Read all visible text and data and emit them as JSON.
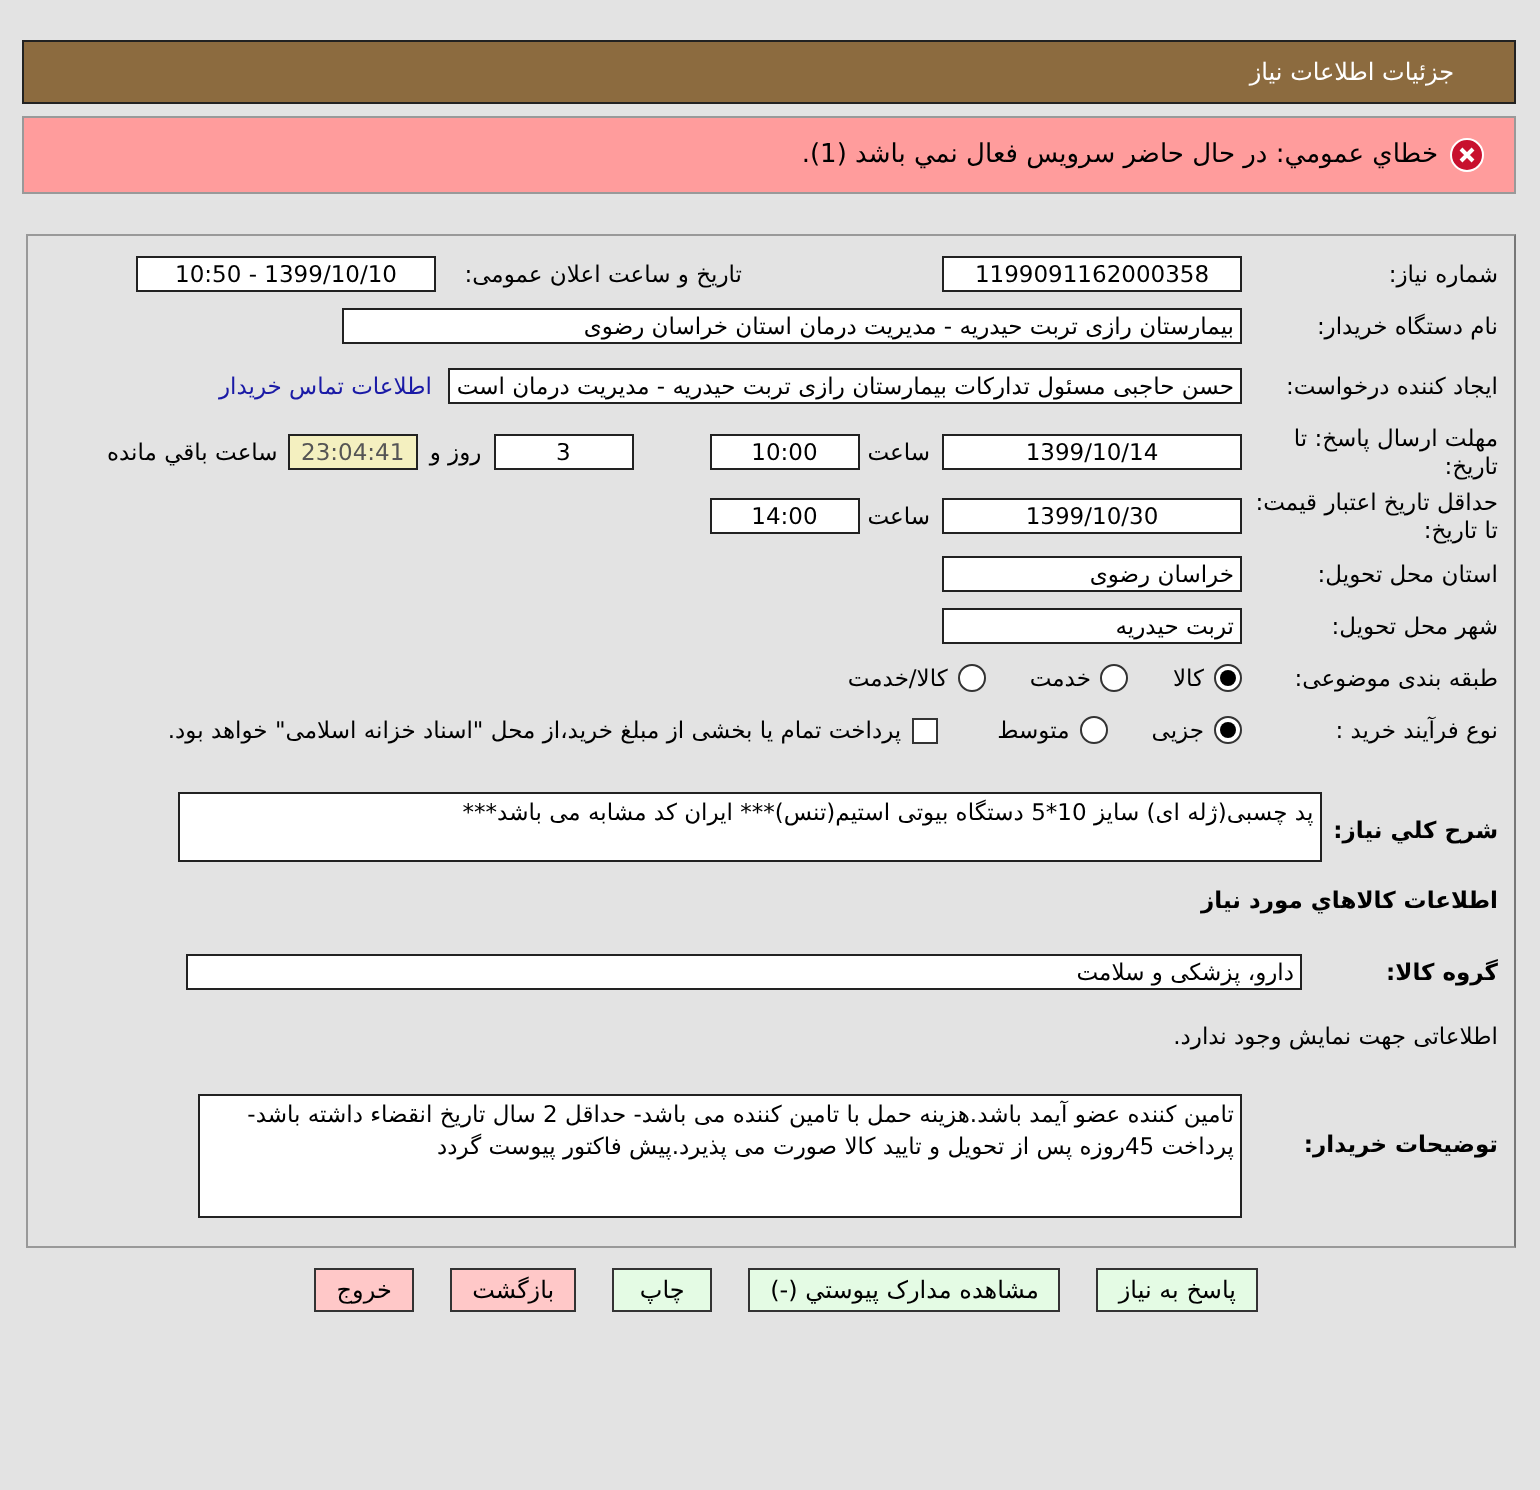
{
  "header": {
    "title": "جزئیات اطلاعات نیاز"
  },
  "error": {
    "message": "خطاي عمومي: در حال حاضر سرويس فعال نمي باشد (1)."
  },
  "need_number": {
    "label": "شماره نیاز:",
    "value": "1199091162000358"
  },
  "announce": {
    "label": "تاریخ و ساعت اعلان عمومی:",
    "value": "1399/10/10 - 10:50"
  },
  "buyer_org": {
    "label": "نام دستگاه خریدار:",
    "value": "بیمارستان رازی تربت حیدریه - مدیریت درمان استان خراسان رضوی"
  },
  "requester": {
    "label": "ایجاد کننده درخواست:",
    "value": "حسن حاجبی مسئول تدارکات بیمارستان رازی تربت حیدریه - مدیریت درمان است",
    "link": "اطلاعات تماس خریدار"
  },
  "deadline": {
    "label": "مهلت ارسال پاسخ: تا تاریخ:",
    "date": "1399/10/14",
    "time_label": "ساعت",
    "time": "10:00",
    "days": "3",
    "days_label": "روز و",
    "remaining": "23:04:41",
    "remaining_label": "ساعت باقي مانده"
  },
  "validity": {
    "label": "حداقل تاریخ اعتبار قیمت: تا تاریخ:",
    "date": "1399/10/30",
    "time_label": "ساعت",
    "time": "14:00"
  },
  "province": {
    "label": "استان محل تحویل:",
    "value": "خراسان رضوی"
  },
  "city": {
    "label": "شهر محل تحویل:",
    "value": "تربت حیدریه"
  },
  "category": {
    "label": "طبقه بندی موضوعی:",
    "options": [
      {
        "label": "کالا",
        "selected": true
      },
      {
        "label": "خدمت",
        "selected": false
      },
      {
        "label": "کالا/خدمت",
        "selected": false
      }
    ]
  },
  "process": {
    "label": "نوع فرآیند خرید :",
    "options": [
      {
        "label": "جزیی",
        "selected": true
      },
      {
        "label": "متوسط",
        "selected": false
      }
    ],
    "payment": {
      "label": "پرداخت تمام یا بخشی از مبلغ خرید،از محل \"اسناد خزانه اسلامی\" خواهد بود.",
      "checked": false
    }
  },
  "description": {
    "label": "شرح کلي نياز:",
    "value": "پد چسبی(ژله ای)  سایز 10*5 دستگاه بیوتی استیم(تنس)*** ایران کد مشابه می باشد***"
  },
  "goods_heading": "اطلاعات کالاهاي مورد نياز",
  "goods_group": {
    "label": "گروه کالا:",
    "value": "دارو، پزشکی و سلامت"
  },
  "no_data": "اطلاعاتی جهت نمایش وجود ندارد.",
  "buyer_notes": {
    "label": "توضیحات خریدار:",
    "value": "تامین کننده عضو آیمد باشد.هزینه حمل با تامین کننده می باشد- حداقل 2 سال  تاریخ انقضاء  داشته باشد-پرداخت 45روزه پس از تحویل و تایید کالا صورت می پذیرد.پیش فاکتور پیوست گردد"
  },
  "buttons": [
    {
      "label": "پاسخ به نیاز",
      "kind": "primary"
    },
    {
      "label": "مشاهده مدارک پیوستي (-)",
      "kind": "primary"
    },
    {
      "label": "چاپ",
      "kind": "primary"
    },
    {
      "label": "بازگشت",
      "kind": "danger"
    },
    {
      "label": "خروج",
      "kind": "danger"
    }
  ]
}
